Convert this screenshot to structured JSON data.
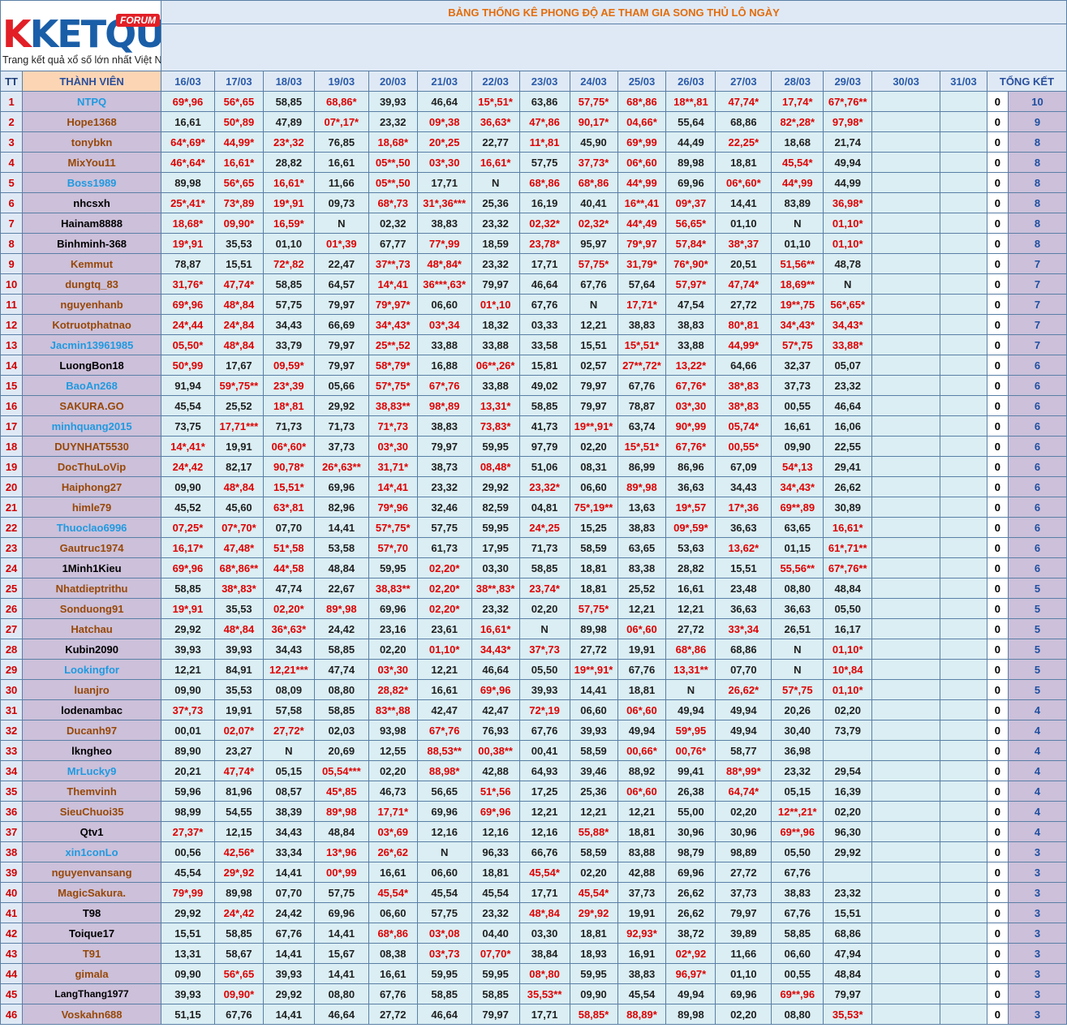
{
  "logo": {
    "brand": "KETQUA2",
    "badge": "FORUM",
    "tagline": "Trang kết quả xổ số lớn nhất Việt Nam"
  },
  "title": "BẢNG THỐNG KÊ PHONG ĐỘ AE THAM GIA SONG THỦ LÔ NGÀY",
  "headers": {
    "tt": "TT",
    "member": "THÀNH VIÊN",
    "total": "TỔNG KẾT"
  },
  "dates": [
    "16/03",
    "17/03",
    "18/03",
    "19/03",
    "20/03",
    "21/03",
    "22/03",
    "23/03",
    "24/03",
    "25/03",
    "26/03",
    "27/03",
    "28/03",
    "29/03",
    "30/03",
    "31/03"
  ],
  "colors": {
    "hit": "#e00000",
    "name_bg": "#ccc0da",
    "cell_bg": "#daeef3",
    "title": "#e36c0a"
  },
  "rows": [
    {
      "tt": "1",
      "name": "NTPQ",
      "color": "blue",
      "v": [
        "69*,96",
        "56*,65",
        "58,85",
        "68,86*",
        "39,93",
        "46,64",
        "15*,51*",
        "63,86",
        "57,75*",
        "68*,86",
        "18**,81",
        "47,74*",
        "17,74*",
        "67*,76**"
      ],
      "zero": "0",
      "total": "10"
    },
    {
      "tt": "2",
      "name": "Hope1368",
      "color": "brown",
      "v": [
        "16,61",
        "50*,89",
        "47,89",
        "07*,17*",
        "23,32",
        "09*,38",
        "36,63*",
        "47*,86",
        "90,17*",
        "04,66*",
        "55,64",
        "68,86",
        "82*,28*",
        "97,98*"
      ],
      "zero": "0",
      "total": "9"
    },
    {
      "tt": "3",
      "name": "tonybkn",
      "color": "brown",
      "v": [
        "64*,69*",
        "44,99*",
        "23*,32",
        "76,85",
        "18,68*",
        "20*,25",
        "22,77",
        "11*,81",
        "45,90",
        "69*,99",
        "44,49",
        "22,25*",
        "18,68",
        "21,74"
      ],
      "zero": "0",
      "total": "8"
    },
    {
      "tt": "4",
      "name": "MixYou11",
      "color": "brown",
      "v": [
        "46*,64*",
        "16,61*",
        "28,82",
        "16,61",
        "05**,50",
        "03*,30",
        "16,61*",
        "57,75",
        "37,73*",
        "06*,60",
        "89,98",
        "18,81",
        "45,54*",
        "49,94"
      ],
      "zero": "0",
      "total": "8"
    },
    {
      "tt": "5",
      "name": "Boss1989",
      "color": "blue",
      "v": [
        "89,98",
        "56*,65",
        "16,61*",
        "11,66",
        "05**,50",
        "17,71",
        "N",
        "68*,86",
        "68*,86",
        "44*,99",
        "69,96",
        "06*,60*",
        "44*,99",
        "44,99"
      ],
      "zero": "0",
      "total": "8"
    },
    {
      "tt": "6",
      "name": "nhcsxh",
      "color": "black",
      "v": [
        "25*,41*",
        "73*,89",
        "19*,91",
        "09,73",
        "68*,73",
        "31*,36***",
        "25,36",
        "16,19",
        "40,41",
        "16**,41",
        "09*,37",
        "14,41",
        "83,89",
        "36,98*"
      ],
      "zero": "0",
      "total": "8"
    },
    {
      "tt": "7",
      "name": "Hainam8888",
      "color": "black",
      "v": [
        "18,68*",
        "09,90*",
        "16,59*",
        "N",
        "02,32",
        "38,83",
        "23,32",
        "02,32*",
        "02,32*",
        "44*,49",
        "56,65*",
        "01,10",
        "N",
        "01,10*"
      ],
      "zero": "0",
      "total": "8"
    },
    {
      "tt": "8",
      "name": "Binhminh-368",
      "color": "black",
      "v": [
        "19*,91",
        "35,53",
        "01,10",
        "01*,39",
        "67,77",
        "77*,99",
        "18,59",
        "23,78*",
        "95,97",
        "79*,97",
        "57,84*",
        "38*,37",
        "01,10",
        "01,10*"
      ],
      "zero": "0",
      "total": "8"
    },
    {
      "tt": "9",
      "name": "Kemmut",
      "color": "brown",
      "v": [
        "78,87",
        "15,51",
        "72*,82",
        "22,47",
        "37**,73",
        "48*,84*",
        "23,32",
        "17,71",
        "57,75*",
        "31,79*",
        "76*,90*",
        "20,51",
        "51,56**",
        "48,78"
      ],
      "zero": "0",
      "total": "7"
    },
    {
      "tt": "10",
      "name": "dungtq_83",
      "color": "brown",
      "v": [
        "31,76*",
        "47,74*",
        "58,85",
        "64,57",
        "14*,41",
        "36***,63*",
        "79,97",
        "46,64",
        "67,76",
        "57,64",
        "57,97*",
        "47,74*",
        "18,69**",
        "N"
      ],
      "zero": "0",
      "total": "7"
    },
    {
      "tt": "11",
      "name": "nguyenhanb",
      "color": "brown",
      "v": [
        "69*,96",
        "48*,84",
        "57,75",
        "79,97",
        "79*,97*",
        "06,60",
        "01*,10",
        "67,76",
        "N",
        "17,71*",
        "47,54",
        "27,72",
        "19**,75",
        "56*,65*"
      ],
      "zero": "0",
      "total": "7"
    },
    {
      "tt": "12",
      "name": "Kotruotphatnao",
      "color": "brown",
      "v": [
        "24*,44",
        "24*,84",
        "34,43",
        "66,69",
        "34*,43*",
        "03*,34",
        "18,32",
        "03,33",
        "12,21",
        "38,83",
        "38,83",
        "80*,81",
        "34*,43*",
        "34,43*"
      ],
      "zero": "0",
      "total": "7"
    },
    {
      "tt": "13",
      "name": "Jacmin13961985",
      "color": "blue",
      "v": [
        "05,50*",
        "48*,84",
        "33,79",
        "79,97",
        "25**,52",
        "33,88",
        "33,88",
        "33,58",
        "15,51",
        "15*,51*",
        "33,88",
        "44,99*",
        "57*,75",
        "33,88*"
      ],
      "zero": "0",
      "total": "7"
    },
    {
      "tt": "14",
      "name": "LuongBon18",
      "color": "black",
      "v": [
        "50*,99",
        "17,67",
        "09,59*",
        "79,97",
        "58*,79*",
        "16,88",
        "06**,26*",
        "15,81",
        "02,57",
        "27**,72*",
        "13,22*",
        "64,66",
        "32,37",
        "05,07"
      ],
      "zero": "0",
      "total": "6"
    },
    {
      "tt": "15",
      "name": "BaoAn268",
      "color": "blue",
      "v": [
        "91,94",
        "59*,75**",
        "23*,39",
        "05,66",
        "57*,75*",
        "67*,76",
        "33,88",
        "49,02",
        "79,97",
        "67,76",
        "67,76*",
        "38*,83",
        "37,73",
        "23,32"
      ],
      "zero": "0",
      "total": "6"
    },
    {
      "tt": "16",
      "name": "SAKURA.GO",
      "color": "brown",
      "v": [
        "45,54",
        "25,52",
        "18*,81",
        "29,92",
        "38,83**",
        "98*,89",
        "13,31*",
        "58,85",
        "79,97",
        "78,87",
        "03*,30",
        "38*,83",
        "00,55",
        "46,64"
      ],
      "zero": "0",
      "total": "6"
    },
    {
      "tt": "17",
      "name": "minhquang2015",
      "color": "blue",
      "v": [
        "73,75",
        "17,71***",
        "71,73",
        "71,73",
        "71*,73",
        "38,83",
        "73,83*",
        "41,73",
        "19**,91*",
        "63,74",
        "90*,99",
        "05,74*",
        "16,61",
        "16,06"
      ],
      "zero": "0",
      "total": "6"
    },
    {
      "tt": "18",
      "name": "DUYNHAT5530",
      "color": "brown",
      "v": [
        "14*,41*",
        "19,91",
        "06*,60*",
        "37,73",
        "03*,30",
        "79,97",
        "59,95",
        "97,79",
        "02,20",
        "15*,51*",
        "67,76*",
        "00,55*",
        "09,90",
        "22,55"
      ],
      "zero": "0",
      "total": "6"
    },
    {
      "tt": "19",
      "name": "DocThuLoVip",
      "color": "brown",
      "v": [
        "24*,42",
        "82,17",
        "90,78*",
        "26*,63**",
        "31,71*",
        "38,73",
        "08,48*",
        "51,06",
        "08,31",
        "86,99",
        "86,96",
        "67,09",
        "54*,13",
        "29,41"
      ],
      "zero": "0",
      "total": "6"
    },
    {
      "tt": "20",
      "name": "Haiphong27",
      "color": "brown",
      "v": [
        "09,90",
        "48*,84",
        "15,51*",
        "69,96",
        "14*,41",
        "23,32",
        "29,92",
        "23,32*",
        "06,60",
        "89*,98",
        "36,63",
        "34,43",
        "34*,43*",
        "26,62"
      ],
      "zero": "0",
      "total": "6"
    },
    {
      "tt": "21",
      "name": "himle79",
      "color": "brown",
      "v": [
        "45,52",
        "45,60",
        "63*,81",
        "82,96",
        "79*,96",
        "32,46",
        "82,59",
        "04,81",
        "75*,19**",
        "13,63",
        "19*,57",
        "17*,36",
        "69**,89",
        "30,89"
      ],
      "zero": "0",
      "total": "6"
    },
    {
      "tt": "22",
      "name": "Thuoclao6996",
      "color": "blue",
      "v": [
        "07,25*",
        "07*,70*",
        "07,70",
        "14,41",
        "57*,75*",
        "57,75",
        "59,95",
        "24*,25",
        "15,25",
        "38,83",
        "09*,59*",
        "36,63",
        "63,65",
        "16,61*"
      ],
      "zero": "0",
      "total": "6"
    },
    {
      "tt": "23",
      "name": "Gautruc1974",
      "color": "brown",
      "v": [
        "16,17*",
        "47,48*",
        "51*,58",
        "53,58",
        "57*,70",
        "61,73",
        "17,95",
        "71,73",
        "58,59",
        "63,65",
        "53,63",
        "13,62*",
        "01,15",
        "61*,71**"
      ],
      "zero": "0",
      "total": "6"
    },
    {
      "tt": "24",
      "name": "1Minh1Kieu",
      "color": "black",
      "v": [
        "69*,96",
        "68*,86**",
        "44*,58",
        "48,84",
        "59,95",
        "02,20*",
        "03,30",
        "58,85",
        "18,81",
        "83,38",
        "28,82",
        "15,51",
        "55,56**",
        "67*,76**"
      ],
      "zero": "0",
      "total": "6"
    },
    {
      "tt": "25",
      "name": "Nhatdieptrithu",
      "color": "brown",
      "v": [
        "58,85",
        "38*,83*",
        "47,74",
        "22,67",
        "38,83**",
        "02,20*",
        "38**,83*",
        "23,74*",
        "18,81",
        "25,52",
        "16,61",
        "23,48",
        "08,80",
        "48,84"
      ],
      "zero": "0",
      "total": "5"
    },
    {
      "tt": "26",
      "name": "Sonduong91",
      "color": "brown",
      "v": [
        "19*,91",
        "35,53",
        "02,20*",
        "89*,98",
        "69,96",
        "02,20*",
        "23,32",
        "02,20",
        "57,75*",
        "12,21",
        "12,21",
        "36,63",
        "36,63",
        "05,50"
      ],
      "zero": "0",
      "total": "5"
    },
    {
      "tt": "27",
      "name": "Hatchau",
      "color": "brown",
      "v": [
        "29,92",
        "48*,84",
        "36*,63*",
        "24,42",
        "23,16",
        "23,61",
        "16,61*",
        "N",
        "89,98",
        "06*,60",
        "27,72",
        "33*,34",
        "26,51",
        "16,17"
      ],
      "zero": "0",
      "total": "5"
    },
    {
      "tt": "28",
      "name": "Kubin2090",
      "color": "black",
      "v": [
        "39,93",
        "39,93",
        "34,43",
        "58,85",
        "02,20",
        "01,10*",
        "34,43*",
        "37*,73",
        "27,72",
        "19,91",
        "68*,86",
        "68,86",
        "N",
        "01,10*"
      ],
      "zero": "0",
      "total": "5"
    },
    {
      "tt": "29",
      "name": "Lookingfor",
      "color": "blue",
      "v": [
        "12,21",
        "84,91",
        "12,21***",
        "47,74",
        "03*,30",
        "12,21",
        "46,64",
        "05,50",
        "19**,91*",
        "67,76",
        "13,31**",
        "07,70",
        "N",
        "10*,84"
      ],
      "zero": "0",
      "total": "5"
    },
    {
      "tt": "30",
      "name": "luanjro",
      "color": "brown",
      "v": [
        "09,90",
        "35,53",
        "08,09",
        "08,80",
        "28,82*",
        "16,61",
        "69*,96",
        "39,93",
        "14,41",
        "18,81",
        "N",
        "26,62*",
        "57*,75",
        "01,10*"
      ],
      "zero": "0",
      "total": "5"
    },
    {
      "tt": "31",
      "name": "lodenambac",
      "color": "black",
      "v": [
        "37*,73",
        "19,91",
        "57,58",
        "58,85",
        "83**,88",
        "42,47",
        "42,47",
        "72*,19",
        "06,60",
        "06*,60",
        "49,94",
        "49,94",
        "20,26",
        "02,20"
      ],
      "zero": "0",
      "total": "4"
    },
    {
      "tt": "32",
      "name": "Ducanh97",
      "color": "brown",
      "v": [
        "00,01",
        "02,07*",
        "27,72*",
        "02,03",
        "93,98",
        "67*,76",
        "76,93",
        "67,76",
        "39,93",
        "49,94",
        "59*,95",
        "49,94",
        "30,40",
        "73,79"
      ],
      "zero": "0",
      "total": "4"
    },
    {
      "tt": "33",
      "name": "lkngheo",
      "color": "black",
      "v": [
        "89,90",
        "23,27",
        "N",
        "20,69",
        "12,55",
        "88,53**",
        "00,38**",
        "00,41",
        "58,59",
        "00,66*",
        "00,76*",
        "58,77",
        "36,98",
        ""
      ],
      "zero": "0",
      "total": "4"
    },
    {
      "tt": "34",
      "name": "MrLucky9",
      "color": "blue",
      "v": [
        "20,21",
        "47,74*",
        "05,15",
        "05,54***",
        "02,20",
        "88,98*",
        "42,88",
        "64,93",
        "39,46",
        "88,92",
        "99,41",
        "88*,99*",
        "23,32",
        "29,54"
      ],
      "zero": "0",
      "total": "4"
    },
    {
      "tt": "35",
      "name": "Themvinh",
      "color": "brown",
      "v": [
        "59,96",
        "81,96",
        "08,57",
        "45*,85",
        "46,73",
        "56,65",
        "51*,56",
        "17,25",
        "25,36",
        "06*,60",
        "26,38",
        "64,74*",
        "05,15",
        "16,39"
      ],
      "zero": "0",
      "total": "4"
    },
    {
      "tt": "36",
      "name": "SieuChuoi35",
      "color": "brown",
      "v": [
        "98,99",
        "54,55",
        "38,39",
        "89*,98",
        "17,71*",
        "69,96",
        "69*,96",
        "12,21",
        "12,21",
        "12,21",
        "55,00",
        "02,20",
        "12**,21*",
        "02,20"
      ],
      "zero": "0",
      "total": "4"
    },
    {
      "tt": "37",
      "name": "Qtv1",
      "color": "black",
      "v": [
        "27,37*",
        "12,15",
        "34,43",
        "48,84",
        "03*,69",
        "12,16",
        "12,16",
        "12,16",
        "55,88*",
        "18,81",
        "30,96",
        "30,96",
        "69**,96",
        "96,30"
      ],
      "zero": "0",
      "total": "4"
    },
    {
      "tt": "38",
      "name": "xin1conLo",
      "color": "blue",
      "v": [
        "00,56",
        "42,56*",
        "33,34",
        "13*,96",
        "26*,62",
        "N",
        "96,33",
        "66,76",
        "58,59",
        "83,88",
        "98,79",
        "98,89",
        "05,50",
        "29,92"
      ],
      "zero": "0",
      "total": "3"
    },
    {
      "tt": "39",
      "name": "nguyenvansang",
      "color": "brown",
      "v": [
        "45,54",
        "29*,92",
        "14,41",
        "00*,99",
        "16,61",
        "06,60",
        "18,81",
        "45,54*",
        "02,20",
        "42,88",
        "69,96",
        "27,72",
        "67,76",
        ""
      ],
      "zero": "0",
      "total": "3"
    },
    {
      "tt": "40",
      "name": "MagicSakura.",
      "color": "brown",
      "v": [
        "79*,99",
        "89,98",
        "07,70",
        "57,75",
        "45,54*",
        "45,54",
        "45,54",
        "17,71",
        "45,54*",
        "37,73",
        "26,62",
        "37,73",
        "38,83",
        "23,32"
      ],
      "zero": "0",
      "total": "3"
    },
    {
      "tt": "41",
      "name": "T98",
      "color": "black",
      "v": [
        "29,92",
        "24*,42",
        "24,42",
        "69,96",
        "06,60",
        "57,75",
        "23,32",
        "48*,84",
        "29*,92",
        "19,91",
        "26,62",
        "79,97",
        "67,76",
        "15,51"
      ],
      "zero": "0",
      "total": "3"
    },
    {
      "tt": "42",
      "name": "Toique17",
      "color": "black",
      "v": [
        "15,51",
        "58,85",
        "67,76",
        "14,41",
        "68*,86",
        "03*,08",
        "04,40",
        "03,30",
        "18,81",
        "92,93*",
        "38,72",
        "39,89",
        "58,85",
        "68,86"
      ],
      "zero": "0",
      "total": "3"
    },
    {
      "tt": "43",
      "name": "T91",
      "color": "brown",
      "v": [
        "13,31",
        "58,67",
        "14,41",
        "15,67",
        "08,38",
        "03*,73",
        "07,70*",
        "38,84",
        "18,93",
        "16,91",
        "02*,92",
        "11,66",
        "06,60",
        "47,94"
      ],
      "zero": "0",
      "total": "3"
    },
    {
      "tt": "44",
      "name": "gimala",
      "color": "brown",
      "v": [
        "09,90",
        "56*,65",
        "39,93",
        "14,41",
        "16,61",
        "59,95",
        "59,95",
        "08*,80",
        "59,95",
        "38,83",
        "96,97*",
        "01,10",
        "00,55",
        "48,84"
      ],
      "zero": "0",
      "total": "3"
    },
    {
      "tt": "45",
      "name": "LangThang1977",
      "color": "black",
      "small": true,
      "v": [
        "39,93",
        "09,90*",
        "29,92",
        "08,80",
        "67,76",
        "58,85",
        "58,85",
        "35,53**",
        "09,90",
        "45,54",
        "49,94",
        "69,96",
        "69**,96",
        "79,97"
      ],
      "zero": "0",
      "total": "3"
    },
    {
      "tt": "46",
      "name": "Voskahn688",
      "color": "brown",
      "v": [
        "51,15",
        "67,76",
        "14,41",
        "46,64",
        "27,72",
        "46,64",
        "79,97",
        "17,71",
        "58,85*",
        "88,89*",
        "89,98",
        "02,20",
        "08,80",
        "35,53*"
      ],
      "zero": "0",
      "total": "3"
    }
  ]
}
